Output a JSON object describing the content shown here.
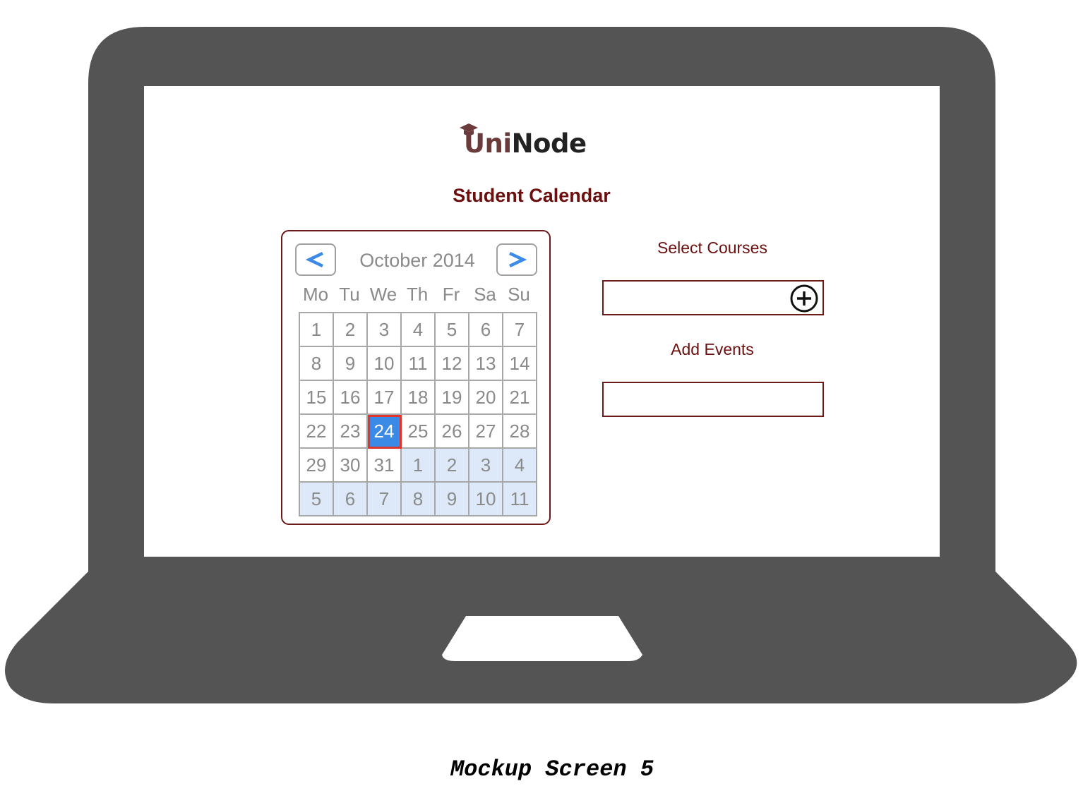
{
  "logo": {
    "part1": "Uni",
    "part2": "Node",
    "cap_icon": "graduation-cap-icon"
  },
  "page_title": "Student Calendar",
  "calendar": {
    "prev_label": "<",
    "next_label": ">",
    "month_year": "October 2014",
    "weekdays": [
      "Mo",
      "Tu",
      "We",
      "Th",
      "Fr",
      "Sa",
      "Su"
    ],
    "days": [
      "1",
      "2",
      "3",
      "4",
      "5",
      "6",
      "7",
      "8",
      "9",
      "10",
      "11",
      "12",
      "13",
      "14",
      "15",
      "16",
      "17",
      "18",
      "19",
      "20",
      "21",
      "22",
      "23",
      "24",
      "25",
      "26",
      "27",
      "28",
      "29",
      "30",
      "31",
      "1",
      "2",
      "3",
      "4",
      "5",
      "6",
      "7",
      "8",
      "9",
      "10",
      "11"
    ],
    "selected_day": "24",
    "nav_color": "#3b8ae6",
    "selected_color": "#3b8ae6",
    "selected_border_color": "#e0352b"
  },
  "select_courses": {
    "label": "Select Courses",
    "value": "",
    "add_icon": "plus-circle-icon"
  },
  "add_events": {
    "label": "Add Events",
    "value": ""
  },
  "caption": "Mockup Screen 5",
  "colors": {
    "accent": "#6b0f0f",
    "laptop": "#545454",
    "other_month_bg": "#dde9f8"
  }
}
